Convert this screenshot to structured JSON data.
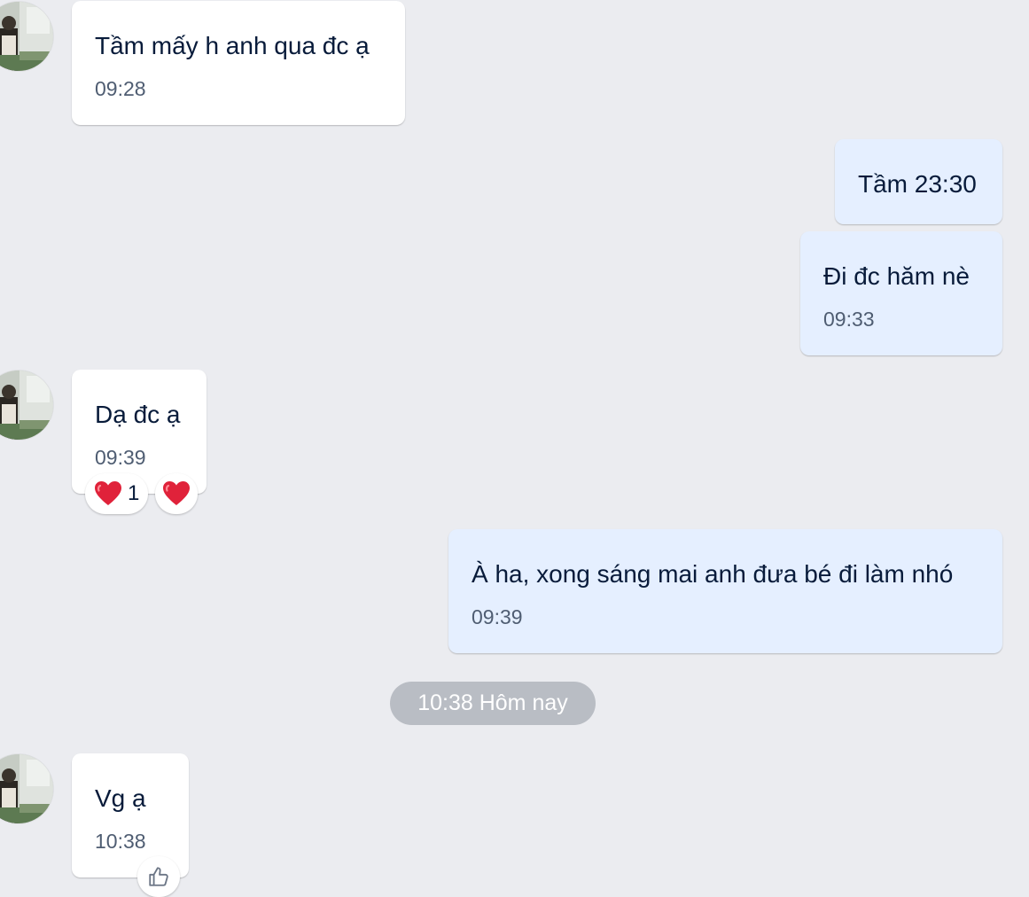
{
  "messages": [
    {
      "direction": "incoming",
      "text": "Tầm mấy h anh qua đc ạ",
      "time": "09:28"
    },
    {
      "direction": "outgoing",
      "text": "Tầm 23:30"
    },
    {
      "direction": "outgoing",
      "text": "Đi đc hăm nè",
      "time": "09:33"
    },
    {
      "direction": "incoming",
      "text": "Dạ đc ạ",
      "time": "09:39",
      "reaction": {
        "icon": "heart-emoji",
        "count": "1"
      }
    },
    {
      "direction": "outgoing",
      "text": "À ha, xong sáng mai anh đưa bé đi làm nhó",
      "time": "09:39"
    },
    {
      "direction": "incoming",
      "text": "Vg ạ",
      "time": "10:38"
    }
  ],
  "date_separator": "10:38 Hôm nay",
  "colors": {
    "background": "#ebecf0",
    "incoming_bubble": "#ffffff",
    "outgoing_bubble": "#e5efff",
    "text": "#081b3a",
    "time": "#4f5d72",
    "separator": "#b9bdc4",
    "heart": "#e0223a"
  }
}
